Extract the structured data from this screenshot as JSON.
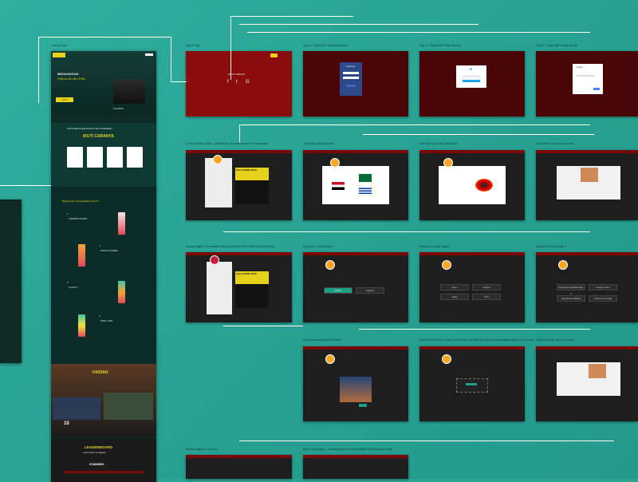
{
  "landing": {
    "label": "Landing Page",
    "hero_line1": "MENANGKAN",
    "hero_line2": "PIALA LELAKI KINI",
    "hero_button": "IKUTI",
    "campaign_tag": "CLASSIC",
    "section_title": "IKUTI CARANYA",
    "section_intro": "Ikuti langkah-langkah berikut untuk mendapatkan",
    "progress_title": "Bagaimana meningkatkan poinmu",
    "stage_labels": [
      "TRAINING ROOM",
      "SOCIAL POWER",
      "LOYALTY",
      "FINAL LINE"
    ],
    "stage_numbers": [
      "1",
      "2",
      "3",
      "4"
    ],
    "prize_title": "HADIAH",
    "prize_count": "10",
    "leaderboard_title": "LEADERBOARD",
    "leaderboard_subtitle": "Lorem ipsum for dolgram",
    "standings_title": "STANDINGS"
  },
  "flow": {
    "row1": [
      {
        "label": "Sign in Page",
        "style": "red"
      },
      {
        "label": "Sign in - Popup With Facebook account",
        "style": "darkred"
      },
      {
        "label": "Sign in - Popup With Twitter Account",
        "style": "darkred"
      },
      {
        "label": "Sign in - Popup With Google account",
        "style": "darkred"
      }
    ],
    "row2": [
      {
        "label": "For the first time popup - complete the data and choose the team support",
        "style": "dark"
      },
      {
        "label": "Select your favorite country",
        "style": "dark"
      },
      {
        "label": "After that it goes you to the profile",
        "style": "dark"
      },
      {
        "label": "Select Photo file from your Device",
        "style": "dark"
      }
    ],
    "row3": [
      {
        "label": "Starting Stage 1 & Contestant Step and upload PONDS MEN purchase receipt",
        "style": "dark"
      },
      {
        "label": "Question 1 in Quiz Stage 1",
        "style": "dark"
      },
      {
        "label": "Question 2 in Quiz Stage 1",
        "style": "dark"
      },
      {
        "label": "Question 3 in Quiz Stage 1",
        "style": "dark"
      }
    ],
    "row4": [
      {
        "label": "Select custom background theme",
        "style": "dark"
      },
      {
        "label": "Drag and Drop file for upload or select file / use Webcam button for get available photo in your device",
        "style": "dark"
      },
      {
        "label": "Select Photo file from your Device",
        "style": "dark"
      }
    ],
    "row5": [
      {
        "label": "Starting Stage 4 in the Quiz",
        "style": "dark"
      },
      {
        "label": "Before Start stage 1, Contestant have to upload PONDS MEN purchase receipt",
        "style": "dark"
      }
    ]
  },
  "signin": {
    "social_title": "MASUK DENGAN",
    "icons": [
      "facebook-icon",
      "twitter-icon",
      "google-icon"
    ],
    "fb_modal_title": "Facebook",
    "google_modal_title": "Google"
  },
  "quiz": {
    "options_q1": [
      "Pemain",
      "Angkatan"
    ],
    "options_q2": [
      "Emas",
      "Duamar",
      "Gelap",
      "Opsi"
    ],
    "options_q3": [
      "Pemain yang di Markas Ingin Ini",
      "Pengen ke Seni",
      "Ada pemain di Markas",
      "Semua ini cuma saja"
    ]
  },
  "banner": {
    "line1": "Step PONDS MAN",
    "line2": "Recharge Yourself with POND'S MEN"
  },
  "colors": {
    "background": "#2aa596",
    "brand_red": "#8a0c0c",
    "brand_yellow": "#e3d11b",
    "accent_teal": "#1fa086"
  }
}
